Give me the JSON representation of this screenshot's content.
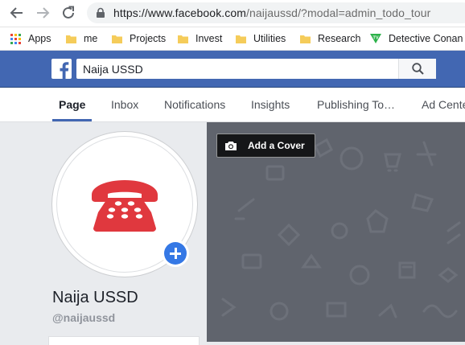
{
  "browser": {
    "url_host": "https://www.facebook.com",
    "url_rest": "/naijaussd/?modal=admin_todo_tour",
    "bookmarks": [
      {
        "label": "Apps",
        "icon": "apps-grid-icon"
      },
      {
        "label": "me",
        "icon": "folder-icon"
      },
      {
        "label": "Projects",
        "icon": "folder-icon"
      },
      {
        "label": "Invest",
        "icon": "folder-icon"
      },
      {
        "label": "Utilities",
        "icon": "folder-icon"
      },
      {
        "label": "Research",
        "icon": "folder-icon"
      },
      {
        "label": "Detective Conan a",
        "icon": "tv-icon"
      }
    ]
  },
  "facebook": {
    "search_value": "Naija USSD",
    "brand_color": "#4267b2"
  },
  "tabs": [
    {
      "label": "Page",
      "active": true
    },
    {
      "label": "Inbox"
    },
    {
      "label": "Notifications"
    },
    {
      "label": "Insights"
    },
    {
      "label": "Publishing To…"
    },
    {
      "label": "Ad Cente"
    }
  ],
  "profile": {
    "name": "Naija USSD",
    "handle": "@naijaussd",
    "icon": "telephone-icon",
    "icon_color": "#e0383e"
  },
  "cover": {
    "button_label": "Add a Cover"
  }
}
